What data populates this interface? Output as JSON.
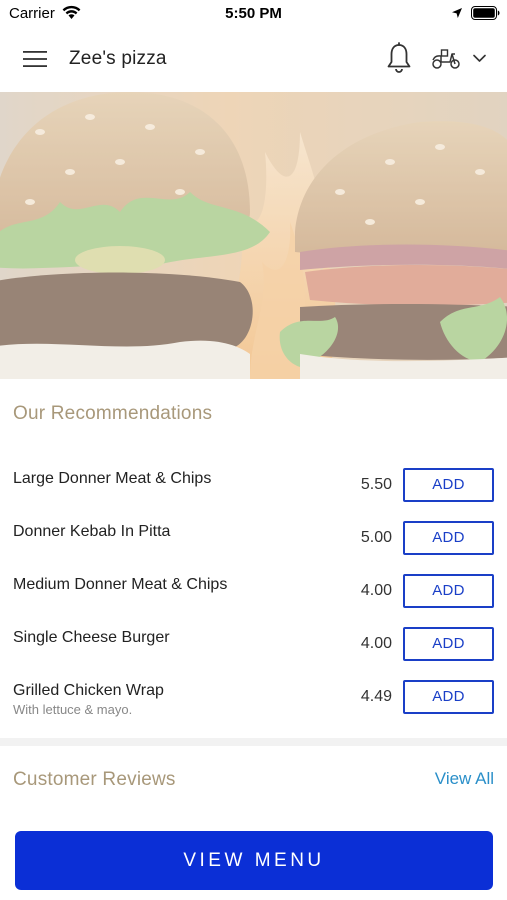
{
  "status_bar": {
    "carrier": "Carrier",
    "time": "5:50 PM"
  },
  "header": {
    "title": "Zee's pizza",
    "icons": [
      "menu-icon",
      "bell-icon",
      "scooter-icon",
      "chevron-down-icon"
    ]
  },
  "recommendations": {
    "title": "Our Recommendations",
    "items": [
      {
        "name": "Large Donner Meat & Chips",
        "description": "",
        "price": "5.50",
        "add_label": "ADD"
      },
      {
        "name": "Donner Kebab In Pitta",
        "description": "",
        "price": "5.00",
        "add_label": "ADD"
      },
      {
        "name": "Medium Donner Meat & Chips",
        "description": "",
        "price": "4.00",
        "add_label": "ADD"
      },
      {
        "name": "Single Cheese Burger",
        "description": "",
        "price": "4.00",
        "add_label": "ADD"
      },
      {
        "name": "Grilled Chicken Wrap",
        "description": "With lettuce & mayo.",
        "price": "4.49",
        "add_label": "ADD"
      }
    ]
  },
  "reviews": {
    "title": "Customer Reviews",
    "view_all_label": "View All"
  },
  "footer": {
    "view_menu_label": "VIEW MENU"
  },
  "colors": {
    "accent_blue": "#0b2fd6",
    "add_border": "#1a3fc7",
    "section_title": "#a8987a",
    "link": "#2a8fc9"
  }
}
